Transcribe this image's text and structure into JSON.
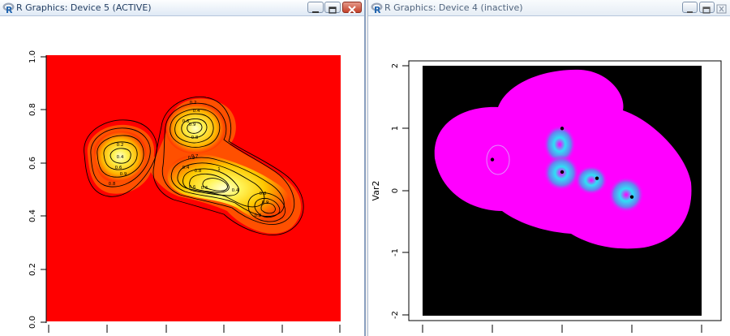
{
  "windows": {
    "left": {
      "title": "R Graphics: Device 5 (ACTIVE)",
      "state": "active",
      "plot": {
        "type": "filled contour",
        "colors": {
          "background": "#ff0000",
          "low": "#ff2a00",
          "mid": "#ffd200",
          "high": "#ffffc8",
          "contour_line": "#000000"
        },
        "y_ticks": [
          "0.0",
          "0.2",
          "0.4",
          "0.6",
          "0.8",
          "1.0"
        ],
        "peaks": [
          {
            "labels": [
              "0.2",
              "0.4",
              "0.6",
              "0.8",
              "0.9"
            ]
          },
          {
            "labels": [
              "0.2",
              "0.4",
              "0.6",
              "0.8",
              "0.9"
            ]
          },
          {
            "labels": [
              "0.2",
              "0.4",
              "0.6",
              "0.7",
              "0.8",
              "1"
            ]
          },
          {
            "labels": [
              "0.2",
              "0.4",
              "0.6",
              "0.8",
              "0.9"
            ]
          }
        ]
      }
    },
    "right": {
      "title": "R Graphics: Device 4 (inactive)",
      "state": "inactive",
      "plot": {
        "type": "raster image",
        "ylabel": "Var2",
        "y_ticks": [
          "-2",
          "-1",
          "0",
          "1",
          "2"
        ],
        "colors": {
          "background": "#000000",
          "fill": "#ff00ff",
          "highlight": "#29d8f5",
          "point": "#000000"
        },
        "points": [
          {
            "x": -1,
            "y": 0.5
          },
          {
            "x": 0,
            "y": 1
          },
          {
            "x": 0,
            "y": 0.3
          },
          {
            "x": 0.5,
            "y": 0.2
          },
          {
            "x": 1,
            "y": -0.1
          }
        ]
      }
    }
  }
}
